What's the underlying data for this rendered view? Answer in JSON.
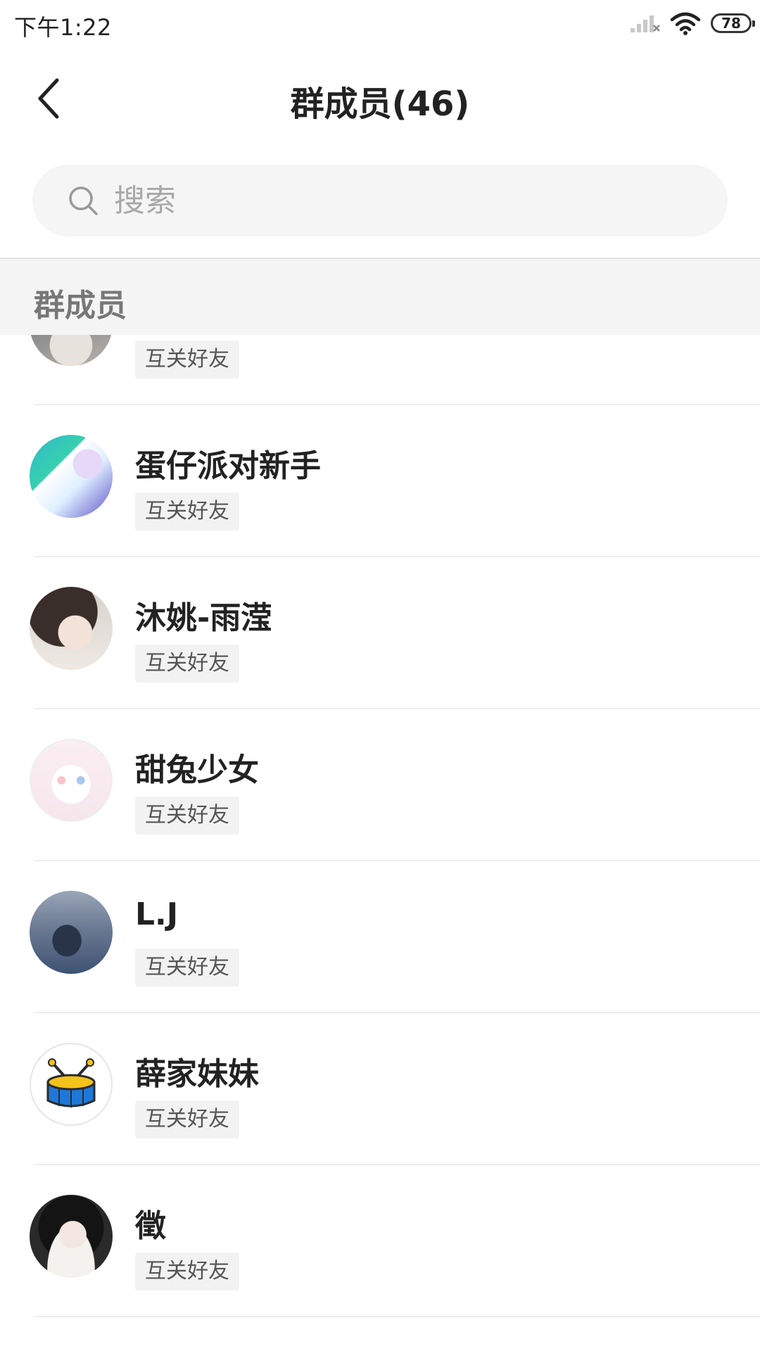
{
  "status_bar": {
    "time": "下午1:22",
    "battery": "78"
  },
  "header": {
    "title": "群成员(46)"
  },
  "search": {
    "placeholder": "搜索"
  },
  "section": {
    "label": "群成员"
  },
  "members": [
    {
      "name": "",
      "tag": "互关好友"
    },
    {
      "name": "蛋仔派对新手",
      "tag": "互关好友"
    },
    {
      "name": "沐姚-雨滢",
      "tag": "互关好友"
    },
    {
      "name": "甜兔少女",
      "tag": "互关好友"
    },
    {
      "name": "L.J",
      "tag": "互关好友"
    },
    {
      "name": "薛家妹妹",
      "tag": "互关好友"
    },
    {
      "name": "徵",
      "tag": "互关好友"
    }
  ]
}
